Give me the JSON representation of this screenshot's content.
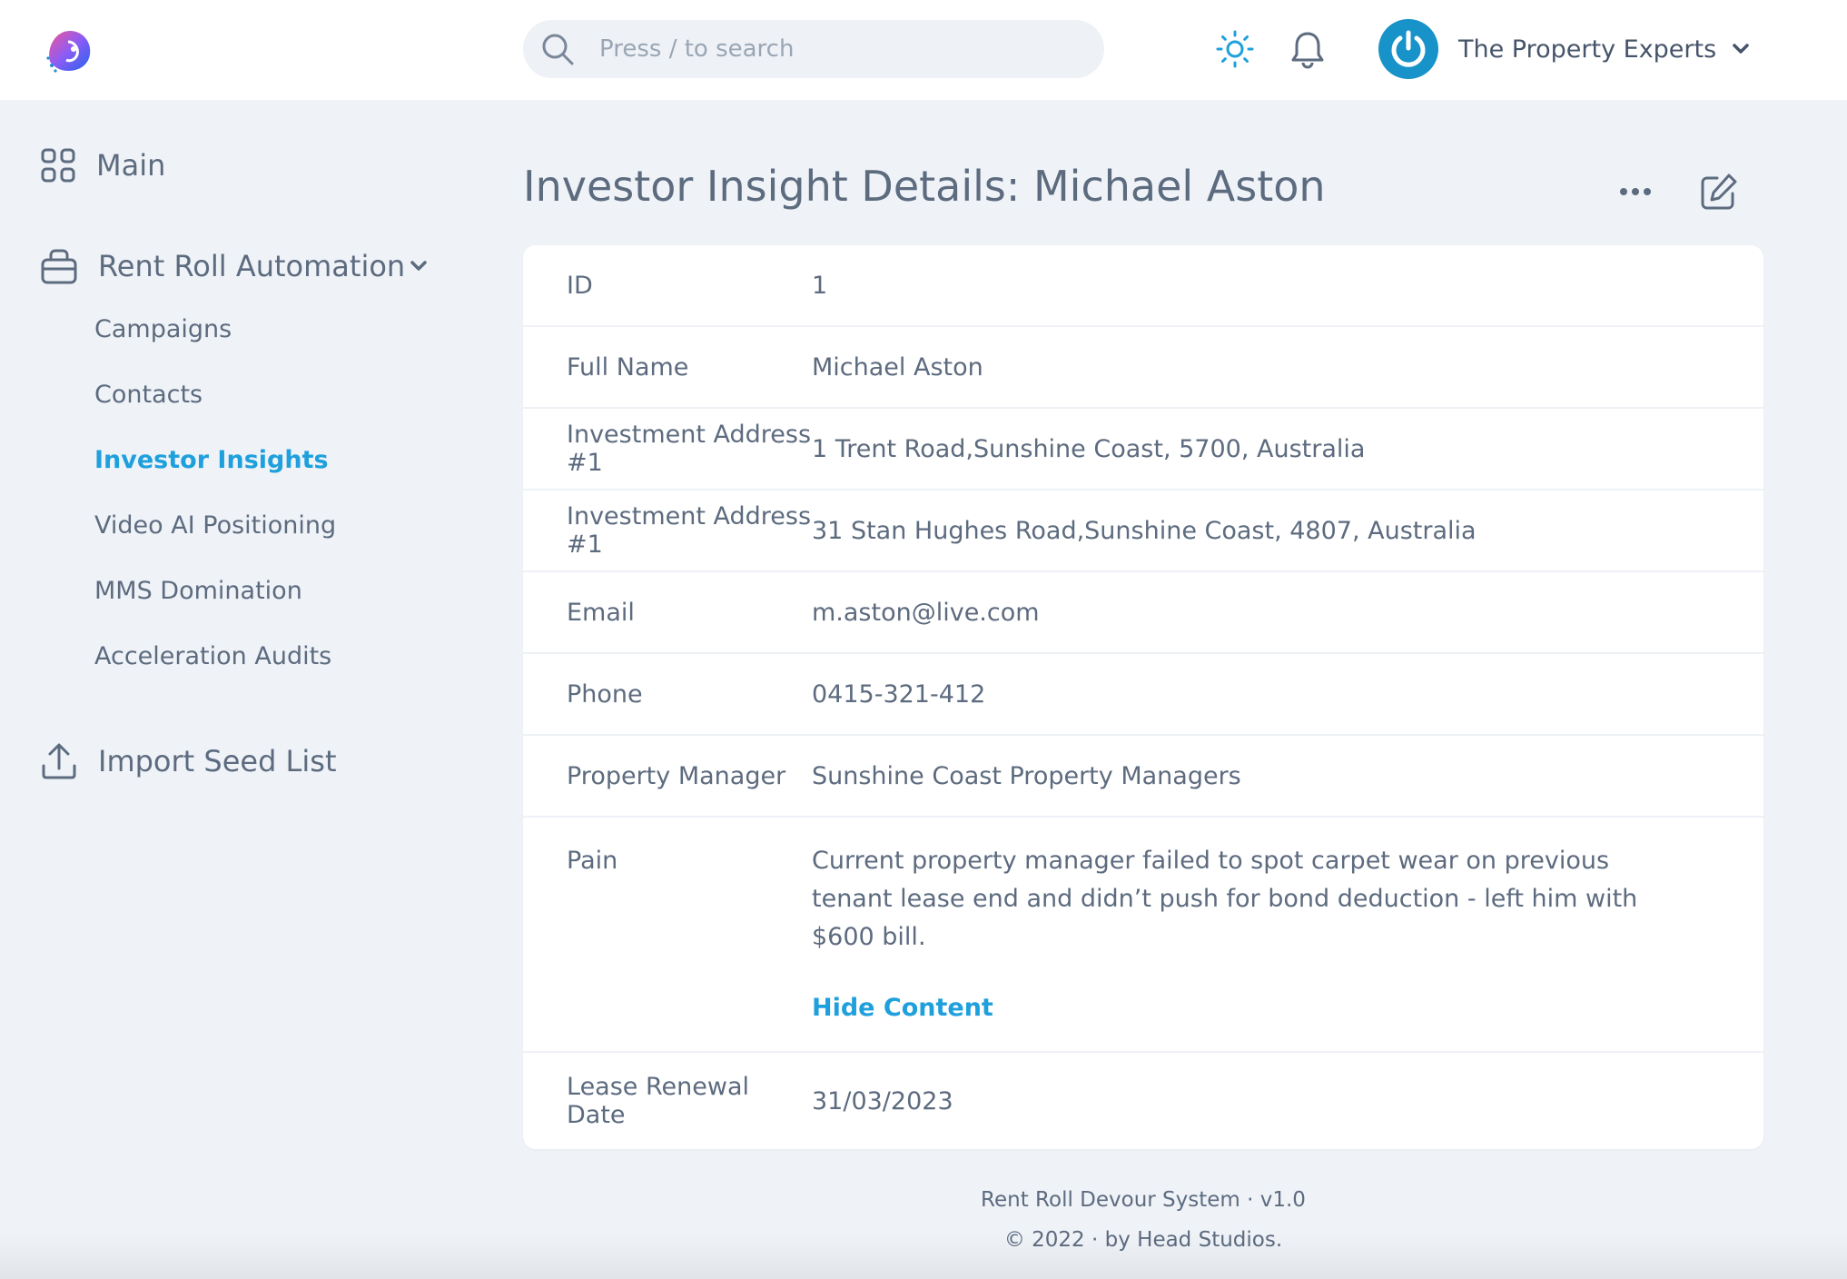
{
  "header": {
    "search_placeholder": "Press / to search",
    "account_name": "The Property Experts"
  },
  "sidebar": {
    "main_label": "Main",
    "section_label": "Rent Roll Automation",
    "items": [
      {
        "label": "Campaigns"
      },
      {
        "label": "Contacts"
      },
      {
        "label": "Investor Insights"
      },
      {
        "label": "Video AI Positioning"
      },
      {
        "label": "MMS Domination"
      },
      {
        "label": "Acceleration Audits"
      }
    ],
    "active_item": "Investor Insights",
    "import_label": "Import Seed List"
  },
  "page": {
    "title": "Investor Insight Details: Michael Aston"
  },
  "details": [
    {
      "key": "ID",
      "value": "1"
    },
    {
      "key": "Full Name",
      "value": "Michael Aston"
    },
    {
      "key": "Investment Address #1",
      "value": "1 Trent Road,Sunshine Coast, 5700, Australia"
    },
    {
      "key": "Investment Address #1",
      "value": "31 Stan Hughes Road,Sunshine Coast, 4807, Australia"
    },
    {
      "key": "Email",
      "value": "m.aston@live.com"
    },
    {
      "key": "Phone",
      "value": "0415-321-412"
    },
    {
      "key": "Property Manager",
      "value": "Sunshine Coast Property Managers"
    }
  ],
  "pain": {
    "key": "Pain",
    "value": "Current property manager failed to spot carpet wear on previous tenant lease end and didn’t push for bond deduction - left him with $600 bill.",
    "toggle_label": "Hide Content"
  },
  "lease": {
    "key": "Lease Renewal Date",
    "value": "31/03/2023"
  },
  "footer": {
    "line1": "Rent Roll Devour System · v1.0",
    "line2": "© 2022 · by Head Studios."
  },
  "colors": {
    "accent": "#1fa0dc",
    "text": "#5d6b7f",
    "background": "#eff3f8",
    "avatar": "#1793c9"
  }
}
